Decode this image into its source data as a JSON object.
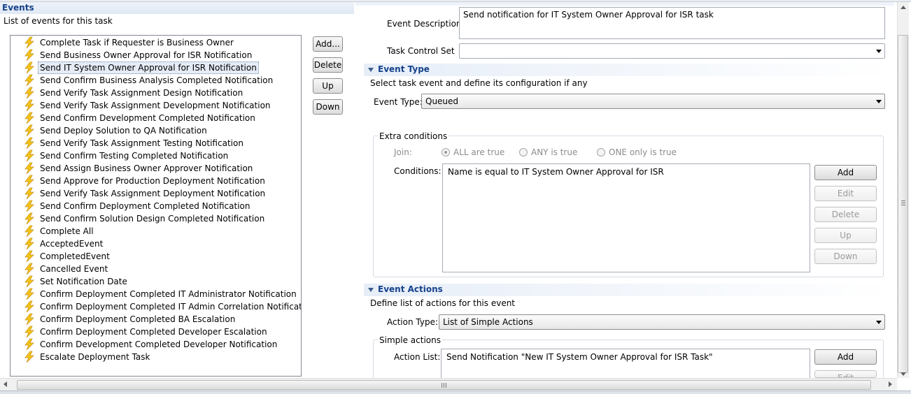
{
  "events_panel": {
    "title": "Events",
    "subtitle": "List of events for this task",
    "items": [
      "Complete Task if Requester is Business Owner",
      "Send Business Owner Approval for ISR Notification",
      "Send IT System Owner Approval for ISR Notification",
      "Send Confirm Business Analysis Completed Notification",
      "Send Verify Task Assignment Design Notification",
      "Send Verify Task Assignment Development Notification",
      "Send Confirm Development Completed Notification",
      "Send Deploy Solution to QA Notification",
      "Send Verify Task Assignment Testing Notification",
      "Send Confirm Testing Completed Notification",
      "Send Assign Business Owner Approver Notification",
      "Send Approve for Production Deployment Notification",
      "Send Verify Task Assignment Deployment Notification",
      "Send Confirm Deployment Completed Notification",
      "Send Confirm Solution Design Completed Notification",
      "Complete All",
      "AcceptedEvent",
      "CompletedEvent",
      "Cancelled Event",
      "Set Notification Date",
      "Confirm Deployment Completed IT Administrator Notification",
      "Confirm Deployment Completed IT Admin Correlation Notification",
      "Confirm Deployment Completed BA Escalation",
      "Confirm Deployment Completed Developer Escalation",
      "Confirm Development Completed Developer Notification",
      "Escalate Deployment Task"
    ],
    "selected_item": "Send IT System Owner Approval for ISR Notification",
    "item_icon": "lightning-bolt-icon",
    "buttons": {
      "add": "Add...",
      "delete": "Delete",
      "up": "Up",
      "down": "Down"
    }
  },
  "details": {
    "event_description_label": "Event Description:",
    "event_description_value": "Send notification for IT System Owner Approval for ISR task",
    "task_control_set_label": "Task Control Set",
    "task_control_set_value": "",
    "event_type_section": {
      "title": "Event Type",
      "description": "Select task event and define its configuration if any",
      "event_type_label": "Event Type:",
      "event_type_value": "Queued"
    },
    "extra_conditions": {
      "title": "Extra conditions",
      "join_label": "Join:",
      "join_options": [
        "ALL are true",
        "ANY is true",
        "ONE only is true"
      ],
      "join_selected": "ALL are true",
      "conditions_label": "Conditions:",
      "conditions_value": "Name is equal to IT System Owner Approval for ISR",
      "buttons": {
        "add": "Add",
        "edit": "Edit",
        "delete": "Delete",
        "up": "Up",
        "down": "Down"
      }
    },
    "event_actions_section": {
      "title": "Event Actions",
      "description": "Define list of actions for this event",
      "action_type_label": "Action Type:",
      "action_type_value": "List of Simple Actions"
    },
    "simple_actions": {
      "title": "Simple actions",
      "action_list_label": "Action List:",
      "action_list_value": "Send Notification \"New IT System Owner Approval for ISR Task\"",
      "buttons": {
        "add": "Add",
        "edit": "Edit"
      }
    }
  },
  "colors": {
    "header_text": "#15428b",
    "selection_bg": "#e5ecf6",
    "icon_yellow": "#f5c518"
  }
}
